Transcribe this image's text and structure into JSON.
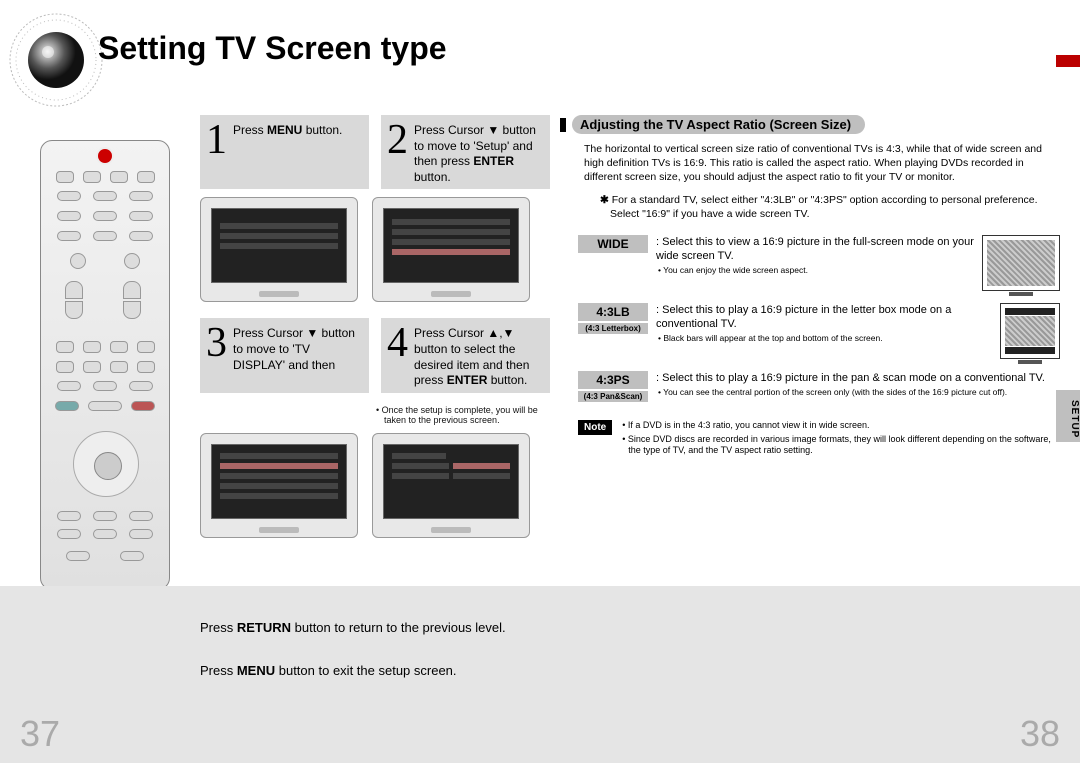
{
  "title": "Setting TV Screen type",
  "steps": [
    {
      "num": "1",
      "html": "Press <b>MENU</b> button."
    },
    {
      "num": "2",
      "html": "Press Cursor ▼ button to move to 'Setup' and then press <b>ENTER</b> button."
    },
    {
      "num": "3",
      "html": "Press Cursor ▼ button to move to 'TV DISPLAY' and then"
    },
    {
      "num": "4",
      "html": "Press Cursor ▲,▼ button to select the desired item and then press <b>ENTER</b> button."
    }
  ],
  "step4_footnote": "• Once the setup is complete, you will be taken to the previous screen.",
  "section_header": "Adjusting the TV Aspect Ratio (Screen Size)",
  "intro": "The horizontal to vertical screen size ratio of conventional TVs is 4:3, while that of wide screen and high definition TVs is 16:9. This ratio is called the aspect ratio. When playing DVDs recorded in different screen size, you should adjust the aspect ratio to fit your TV or monitor.",
  "star_note": "For a standard TV, select either \"4:3LB\" or \"4:3PS\" option according to personal preference. Select \"16:9\" if you have a wide screen TV.",
  "options": [
    {
      "main": "WIDE",
      "sub": "",
      "desc": ": Select this to view a 16:9 picture in the full-screen mode on your wide screen TV.",
      "bullet": "• You can enjoy the wide screen aspect.",
      "illus": "wide"
    },
    {
      "main": "4:3LB",
      "sub": "(4:3 Letterbox)",
      "desc": ": Select this to play a 16:9 picture in the letter box mode on a conventional TV.",
      "bullet": "• Black bars will appear at the top and bottom of the screen.",
      "illus": "lb"
    },
    {
      "main": "4:3PS",
      "sub": "(4:3 Pan&Scan)",
      "desc": ": Select this to play a 16:9 picture in the pan & scan mode on a conventional TV.",
      "bullet": "• You can see the central portion of the screen only (with the sides of the 16:9 picture cut off).",
      "illus": ""
    }
  ],
  "note_label": "Note",
  "notes": [
    "• If a DVD is in the 4:3 ratio, you cannot view it in wide screen.",
    "• Since DVD discs are recorded in various image formats, they will look different depending on the software, the type of TV, and the TV aspect ratio setting."
  ],
  "side_tab": "SETUP",
  "footer": {
    "return": "Press RETURN button to return to the previous level.",
    "menu": "Press MENU button to exit the setup screen."
  },
  "pages": {
    "left": "37",
    "right": "38"
  }
}
